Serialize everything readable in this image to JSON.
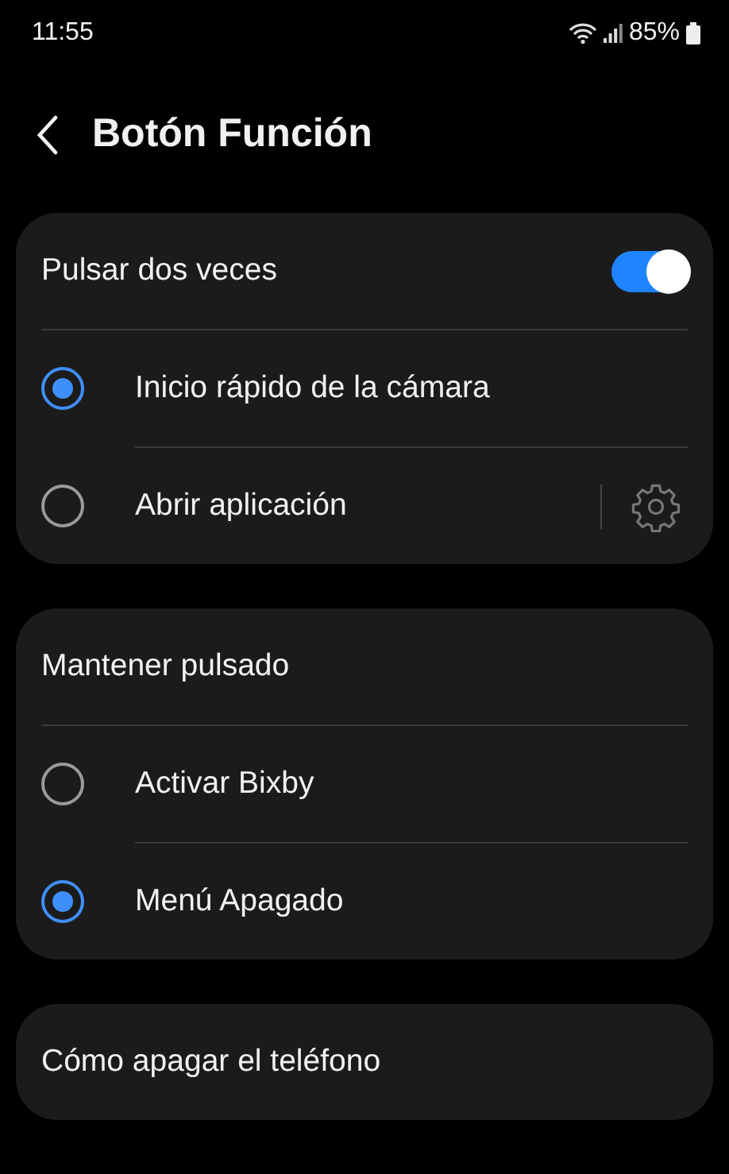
{
  "status_bar": {
    "time": "11:55",
    "battery": "85%"
  },
  "header": {
    "title": "Botón Función"
  },
  "groups": [
    {
      "items": [
        {
          "kind": "switch",
          "label": "Pulsar dos veces",
          "on": true
        },
        {
          "kind": "radio",
          "label": "Inicio rápido de la cámara",
          "selected": true,
          "settings_button": false
        },
        {
          "kind": "radio",
          "label": "Abrir aplicación",
          "selected": false,
          "settings_button": true
        }
      ]
    },
    {
      "items": [
        {
          "kind": "heading",
          "label": "Mantener pulsado"
        },
        {
          "kind": "radio",
          "label": "Activar Bixby",
          "selected": false,
          "settings_button": false
        },
        {
          "kind": "radio",
          "label": "Menú Apagado",
          "selected": true,
          "settings_button": false
        }
      ]
    },
    {
      "items": [
        {
          "kind": "link",
          "label": "Cómo apagar el teléfono"
        }
      ]
    }
  ]
}
